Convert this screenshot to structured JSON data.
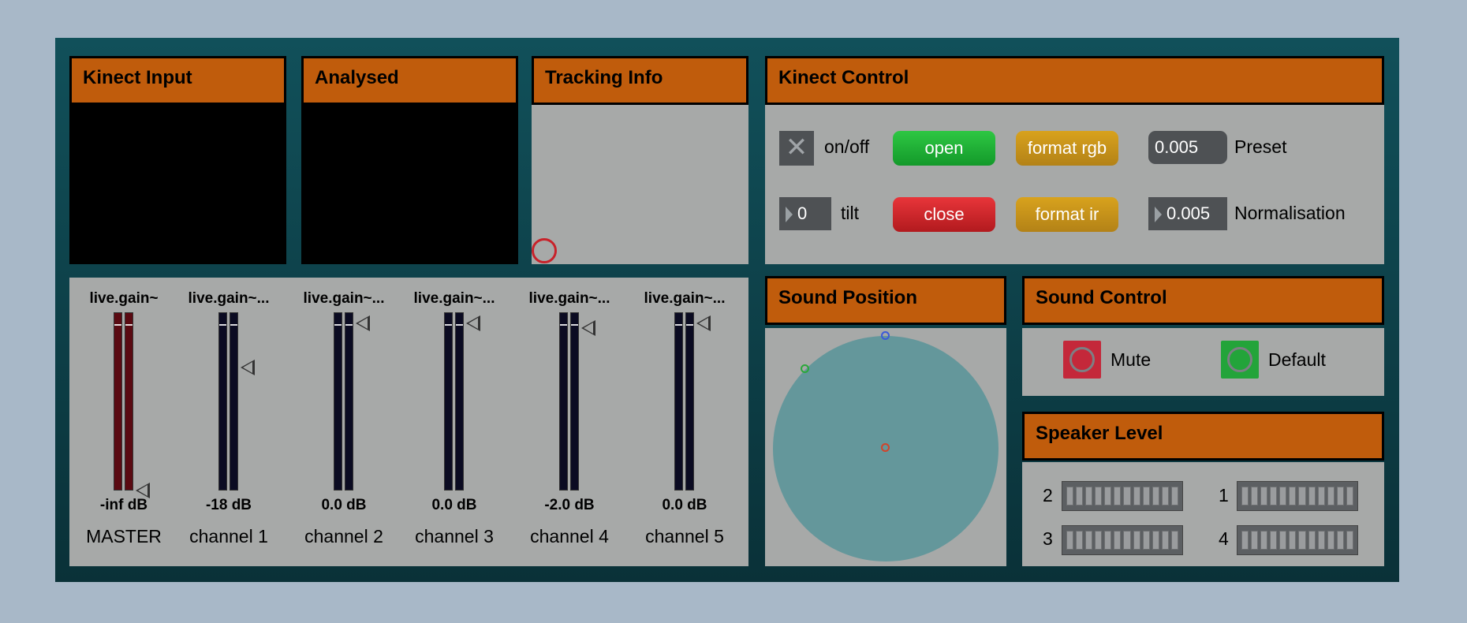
{
  "panels": {
    "kinect_input": "Kinect Input",
    "analysed": "Analysed",
    "tracking_info": "Tracking Info",
    "kinect_control": "Kinect Control",
    "sound_position": "Sound Position",
    "sound_control": "Sound Control",
    "speaker_level": "Speaker Level"
  },
  "kinect_control": {
    "onoff_label": "on/off",
    "open_label": "open",
    "close_label": "close",
    "format_rgb_label": "format rgb",
    "format_ir_label": "format ir",
    "preset_value": "0.005",
    "preset_label": "Preset",
    "tilt_value": "0",
    "tilt_label": "tilt",
    "normalisation_value": "0.005",
    "normalisation_label": "Normalisation"
  },
  "gains": [
    {
      "name": "live.gain~",
      "value": "-inf dB",
      "channel": "MASTER",
      "level": 0.0
    },
    {
      "name": "live.gain~...",
      "value": "-18 dB",
      "channel": "channel 1",
      "level": 0.69
    },
    {
      "name": "live.gain~...",
      "value": "0.0 dB",
      "channel": "channel 2",
      "level": 0.94
    },
    {
      "name": "live.gain~...",
      "value": "0.0 dB",
      "channel": "channel 3",
      "level": 0.94
    },
    {
      "name": "live.gain~...",
      "value": "-2.0 dB",
      "channel": "channel 4",
      "level": 0.91
    },
    {
      "name": "live.gain~...",
      "value": "0.0 dB",
      "channel": "channel 5",
      "level": 0.94
    }
  ],
  "sound_control": {
    "mute_label": "Mute",
    "default_label": "Default",
    "mute_color": "#c4283a",
    "default_color": "#23a43a"
  },
  "speaker_level": {
    "speakers": [
      "2",
      "1",
      "3",
      "4"
    ]
  },
  "colors": {
    "header": "#c05c0c",
    "panel": "#a7a9a8",
    "frame": "#0e4650",
    "circle": "#64979b"
  }
}
